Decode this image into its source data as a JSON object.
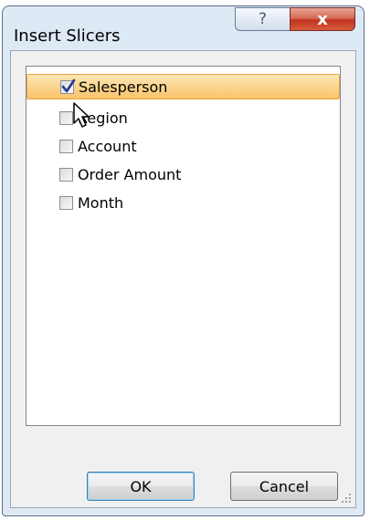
{
  "window": {
    "title": "Insert Slicers",
    "help_label": "?",
    "close_label": "x"
  },
  "fields": [
    {
      "label": "Salesperson",
      "checked": true,
      "selected": true
    },
    {
      "label": "Region",
      "checked": false,
      "selected": false
    },
    {
      "label": "Account",
      "checked": false,
      "selected": false
    },
    {
      "label": "Order Amount",
      "checked": false,
      "selected": false
    },
    {
      "label": "Month",
      "checked": false,
      "selected": false
    }
  ],
  "buttons": {
    "ok_label": "OK",
    "cancel_label": "Cancel"
  },
  "colors": {
    "selection": "#f9c46c",
    "close_button": "#c0321f",
    "window_frame": "#dde9f5"
  }
}
